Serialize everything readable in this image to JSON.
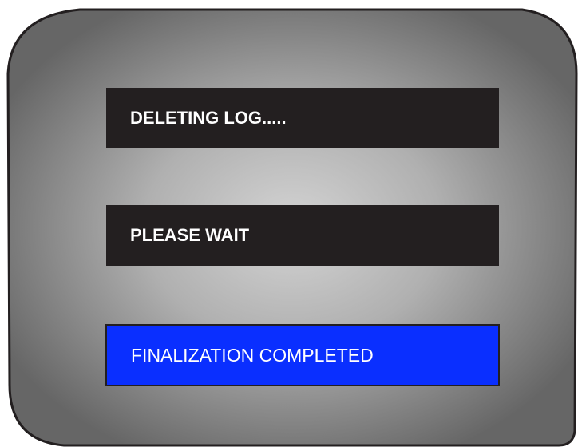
{
  "device_screen": {
    "colors": {
      "bezel_center": "#d0d0d0",
      "bezel_edge": "#6e6e6e",
      "bezel_outline": "#231f20",
      "dark_bar": "#231f20",
      "status_bar": "#0a2fff",
      "text": "#ffffff"
    },
    "messages": {
      "deleting": "DELETING LOG.....",
      "wait": "PLEASE WAIT",
      "finalization": "FINALIZATION COMPLETED"
    }
  }
}
